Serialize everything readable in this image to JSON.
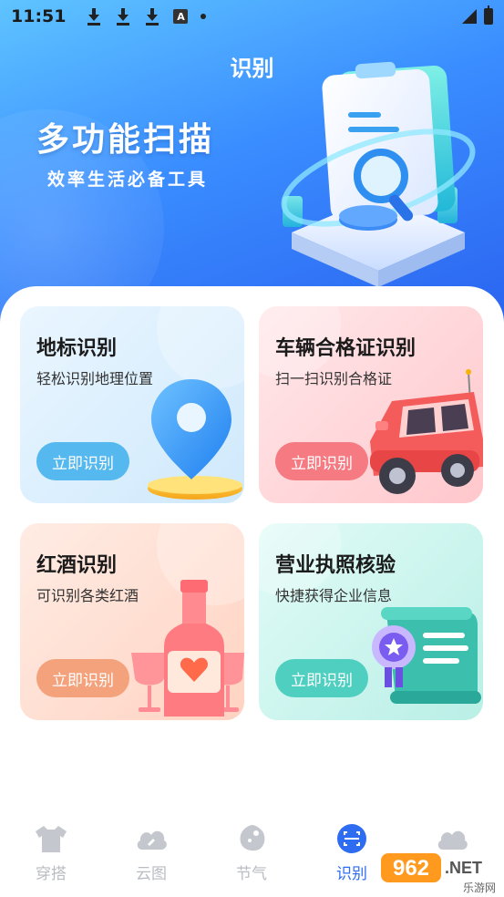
{
  "status_bar": {
    "time": "11:51",
    "letter_icon": "A"
  },
  "header": {
    "title": "识别",
    "hero_title": "多功能扫描",
    "hero_subtitle": "效率生活必备工具"
  },
  "cards": [
    {
      "title": "地标识别",
      "subtitle": "轻松识别地理位置",
      "button": "立即识别",
      "icon": "map-pin-icon",
      "accent": "#55b8ee"
    },
    {
      "title": "车辆合格证识别",
      "subtitle": "扫一扫识别合格证",
      "button": "立即识别",
      "icon": "car-icon",
      "accent": "#f57a82"
    },
    {
      "title": "红酒识别",
      "subtitle": "可识别各类红酒",
      "button": "立即识别",
      "icon": "wine-bottle-icon",
      "accent": "#f4a27c"
    },
    {
      "title": "营业执照核验",
      "subtitle": "快捷获得企业信息",
      "button": "立即识别",
      "icon": "license-certificate-icon",
      "accent": "#4fcfc0"
    }
  ],
  "bottom_nav": {
    "items": [
      {
        "label": "穿搭",
        "icon": "shirt-icon",
        "active": false
      },
      {
        "label": "云图",
        "icon": "cloud-icon",
        "active": false
      },
      {
        "label": "节气",
        "icon": "leaf-icon",
        "active": false
      },
      {
        "label": "识别",
        "icon": "scan-icon",
        "active": true
      },
      {
        "label": "",
        "icon": "weather-cloud-icon",
        "active": false
      }
    ],
    "active_color": "#2e6cf2",
    "inactive_color": "#b9bcc3"
  },
  "watermark": {
    "logo_text": "962",
    "suffix": ".NET",
    "site_name": "乐游网"
  }
}
